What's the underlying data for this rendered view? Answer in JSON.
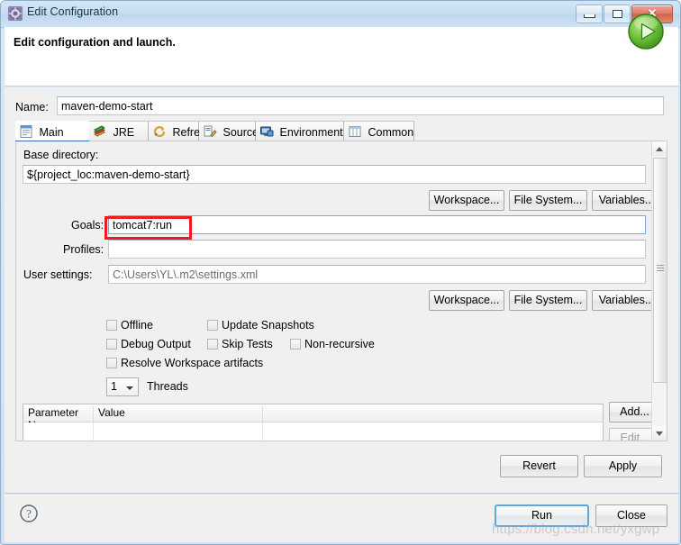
{
  "window": {
    "title": "Edit Configuration",
    "icon": "launch-config-icon",
    "minimize": "minimize-icon",
    "maximize": "maximize-icon",
    "close": "close-icon",
    "close_glyph": "✕"
  },
  "header": {
    "title": "Edit configuration and launch.",
    "badge_icon": "run-green-play-icon"
  },
  "name_field": {
    "label": "Name:",
    "value": "maven-demo-start"
  },
  "tabs": [
    {
      "label": "Main",
      "icon": "main-tab-icon",
      "active": true
    },
    {
      "label": "JRE",
      "icon": "jre-tab-icon",
      "active": false
    },
    {
      "label": "Refresh",
      "icon": "refresh-tab-icon",
      "active": false
    },
    {
      "label": "Source",
      "icon": "source-tab-icon",
      "active": false
    },
    {
      "label": "Environment",
      "icon": "environment-tab-icon",
      "active": false
    },
    {
      "label": "Common",
      "icon": "common-tab-icon",
      "active": false
    }
  ],
  "main_tab": {
    "base_directory": {
      "label": "Base directory:",
      "value": "${project_loc:maven-demo-start}"
    },
    "base_buttons": [
      {
        "label": "Workspace..."
      },
      {
        "label": "File System..."
      },
      {
        "label": "Variables..."
      }
    ],
    "goals": {
      "label": "Goals:",
      "value": "tomcat7:run",
      "annotated": true,
      "annotation_color": "#ee1b24"
    },
    "profiles": {
      "label": "Profiles:",
      "value": ""
    },
    "user_settings": {
      "label": "User settings:",
      "value": "C:\\Users\\YL\\.m2\\settings.xml"
    },
    "settings_buttons": [
      {
        "label": "Workspace..."
      },
      {
        "label": "File System..."
      },
      {
        "label": "Variables..."
      }
    ],
    "checkboxes": [
      {
        "label": "Offline",
        "checked": false
      },
      {
        "label": "Update Snapshots",
        "checked": false
      },
      {
        "label": "Debug Output",
        "checked": false
      },
      {
        "label": "Skip Tests",
        "checked": false
      },
      {
        "label": "Non-recursive",
        "checked": false
      },
      {
        "label": "Resolve Workspace artifacts",
        "checked": false
      }
    ],
    "threads": {
      "value": "1",
      "label": "Threads"
    },
    "parameter_table": {
      "columns": [
        "Parameter Name",
        "Value",
        ""
      ],
      "rows": []
    },
    "table_buttons": [
      {
        "label": "Add...",
        "enabled": true
      },
      {
        "label": "Edit...",
        "enabled": false
      }
    ]
  },
  "apply_bar": {
    "revert": "Revert",
    "apply": "Apply"
  },
  "footer": {
    "help_icon": "help-question-icon",
    "run": "Run",
    "close": "Close"
  },
  "watermark": "https://blog.csdn.net/yxgwp"
}
